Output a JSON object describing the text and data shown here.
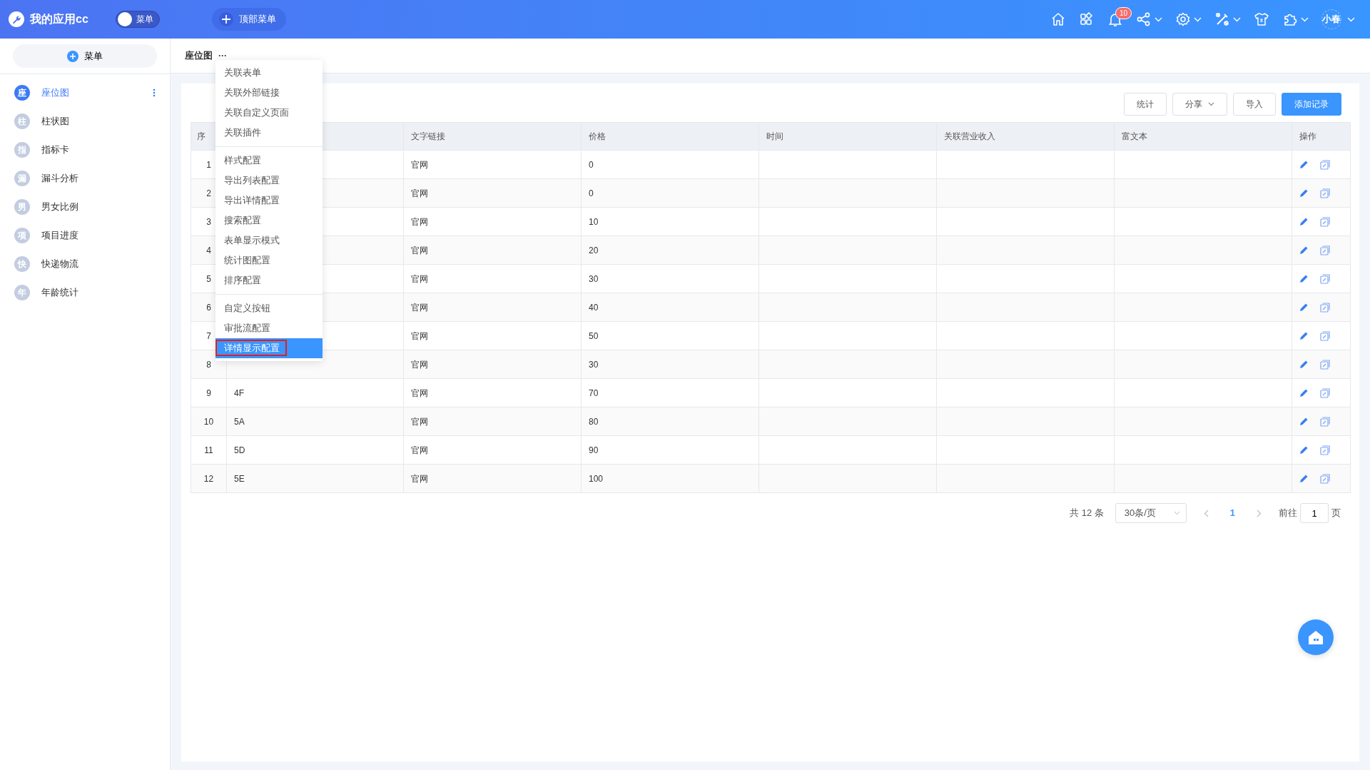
{
  "topbar": {
    "app_title": "我的应用cc",
    "menu_toggle": {
      "label": "菜单",
      "on": false
    },
    "top_menu_button": "顶部菜单",
    "icons": [
      {
        "kind": "home",
        "dropdown": false
      },
      {
        "kind": "apps",
        "dropdown": false
      },
      {
        "kind": "bell",
        "dropdown": false,
        "badge": "10"
      },
      {
        "kind": "share",
        "dropdown": true
      },
      {
        "kind": "gear",
        "dropdown": true
      },
      {
        "kind": "tools",
        "dropdown": true
      },
      {
        "kind": "shirt",
        "dropdown": false
      },
      {
        "kind": "puzzle",
        "dropdown": true
      }
    ],
    "user": {
      "name": "小春",
      "dropdown": true
    }
  },
  "sidebar": {
    "add_button": "菜单",
    "items": [
      {
        "icon_char": "座",
        "label": "座位图",
        "selected": true
      },
      {
        "icon_char": "柱",
        "label": "柱状图",
        "selected": false
      },
      {
        "icon_char": "指",
        "label": "指标卡",
        "selected": false
      },
      {
        "icon_char": "漏",
        "label": "漏斗分析",
        "selected": false
      },
      {
        "icon_char": "男",
        "label": "男女比例",
        "selected": false
      },
      {
        "icon_char": "项",
        "label": "项目进度",
        "selected": false
      },
      {
        "icon_char": "快",
        "label": "快递物流",
        "selected": false
      },
      {
        "icon_char": "年",
        "label": "年龄统计",
        "selected": false
      }
    ]
  },
  "breadcrumb": {
    "title": "座位图",
    "more": "···"
  },
  "dropdown_menu": {
    "groups": [
      [
        {
          "label": "关联表单",
          "selected": false
        },
        {
          "label": "关联外部链接",
          "selected": false
        },
        {
          "label": "关联自定义页面",
          "selected": false
        },
        {
          "label": "关联插件",
          "selected": false
        }
      ],
      [
        {
          "label": "样式配置",
          "selected": false
        },
        {
          "label": "导出列表配置",
          "selected": false
        },
        {
          "label": "导出详情配置",
          "selected": false
        },
        {
          "label": "搜索配置",
          "selected": false
        },
        {
          "label": "表单显示模式",
          "selected": false
        },
        {
          "label": "统计图配置",
          "selected": false
        },
        {
          "label": "排序配置",
          "selected": false
        }
      ],
      [
        {
          "label": "自定义按钮",
          "selected": false
        },
        {
          "label": "审批流配置",
          "selected": false
        },
        {
          "label": "详情显示配置",
          "selected": true
        }
      ]
    ]
  },
  "actions": [
    {
      "label": "统计",
      "kind": "default"
    },
    {
      "label": "分享",
      "kind": "dropdown"
    },
    {
      "label": "导入",
      "kind": "default"
    },
    {
      "label": "添加记录",
      "kind": "primary"
    }
  ],
  "table": {
    "header": {
      "index": "序",
      "text_link": "文字链接",
      "price": "价格",
      "time": "时间",
      "revenue": "关联营业收入",
      "rich_text": "富文本",
      "actions": "操作"
    },
    "rows": [
      {
        "index": "1",
        "text_link": "官网",
        "price": "0"
      },
      {
        "index": "2",
        "text_link": "官网",
        "price": "0"
      },
      {
        "index": "3",
        "text_link": "官网",
        "price": "10"
      },
      {
        "index": "4",
        "text_link": "官网",
        "price": "20"
      },
      {
        "index": "5",
        "text_link": "官网",
        "price": "30"
      },
      {
        "index": "6",
        "text_link": "官网",
        "price": "40"
      },
      {
        "index": "7",
        "text_link": "官网",
        "price": "50"
      },
      {
        "index": "8",
        "text_link": "官网",
        "price": "30"
      },
      {
        "index": "9",
        "column_2": "4F",
        "text_link": "官网",
        "price": "70"
      },
      {
        "index": "10",
        "column_2": "5A",
        "text_link": "官网",
        "price": "80"
      },
      {
        "index": "11",
        "column_2": "5D",
        "text_link": "官网",
        "price": "90"
      },
      {
        "index": "12",
        "column_2": "5E",
        "text_link": "官网",
        "price": "100"
      }
    ]
  },
  "pagination": {
    "total": "共 12 条",
    "page_size": "30条/页",
    "pages": [
      {
        "label": "1",
        "selected": true
      }
    ],
    "goto_label": "前往",
    "goto_value": "1",
    "page_suffix": "页"
  }
}
